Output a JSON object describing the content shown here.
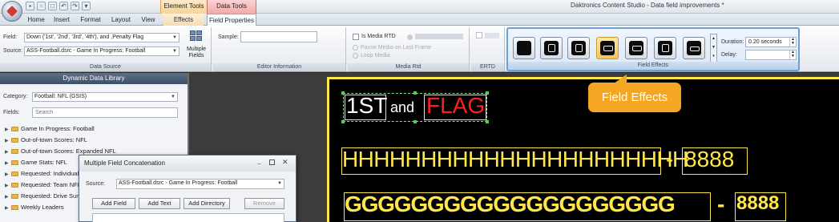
{
  "window": {
    "title": "Daktronics Content Studio - Data field improvements *"
  },
  "contextual_headers": {
    "element_tools": "Element Tools",
    "data_tools": "Data Tools"
  },
  "tabs": [
    "Home",
    "Insert",
    "Format",
    "Layout",
    "View",
    "Effects",
    "Field Properties"
  ],
  "data_source": {
    "field_label": "Field:",
    "field_value": "Down ('1st', '2nd', '3rd', '4th'), and ,Penalty Flag",
    "source_label": "Source:",
    "source_value": "ASS-Football.dsrc - Game In Progress: Football",
    "multiple_fields": "Multiple Fields",
    "group_label": "Data Source"
  },
  "editor_info": {
    "sample_label": "Sample:",
    "sample_value": "",
    "group_label": "Editor Information"
  },
  "media_rtd": {
    "is_media_rtd": "Is Media RTD",
    "pause_media": "Pause Media on Last Frame",
    "loop_media": "Loop Media",
    "group_label": "Media Rtd"
  },
  "ertd": {
    "group_label": "ERTD"
  },
  "field_effects": {
    "group_label": "Field Effects",
    "duration_label": "Duration:",
    "duration_value": "0.20 seconds",
    "delay_label": "Delay:",
    "delay_value": ""
  },
  "library": {
    "title": "Dynamic Data Library",
    "category_label": "Category:",
    "category_value": "Football: NFL (GSIS)",
    "fields_label": "Fields:",
    "search_placeholder": "Search",
    "items": [
      "Game In Progress: Football",
      "Out-of-town Scores: NFL",
      "Out-of-town Scores: Expanded NFL",
      "Game Stats: NFL",
      "Requested: Individual",
      "Requested: Team NFL",
      "Requested: Drive Sum",
      "Weekly Leaders"
    ]
  },
  "concat_dialog": {
    "title": "Multiple Field Concatenation",
    "source_label": "Source:",
    "source_value": "ASS-Football.dsrc - Game In Progress: Football",
    "add_field": "Add Field",
    "add_text": "Add Text",
    "add_directory": "Add Directory",
    "remove": "Remove"
  },
  "canvas": {
    "down_text": "1ST",
    "and_text": "and",
    "flag_text": "FLAG",
    "row2_text": "HHHHHHHHHHHHHHHHHHHHHH",
    "row2_sep": "-",
    "row2_num": "8888",
    "row3_text": "GGGGGGGGGGGGGGGGGGGG",
    "row3_sep": "-",
    "row3_num": "8888"
  },
  "callout": {
    "text": "Field Effects"
  },
  "colors": {
    "accent_callout": "#f5a623",
    "led_yellow": "#ffe64a",
    "led_red": "#ff2020"
  }
}
